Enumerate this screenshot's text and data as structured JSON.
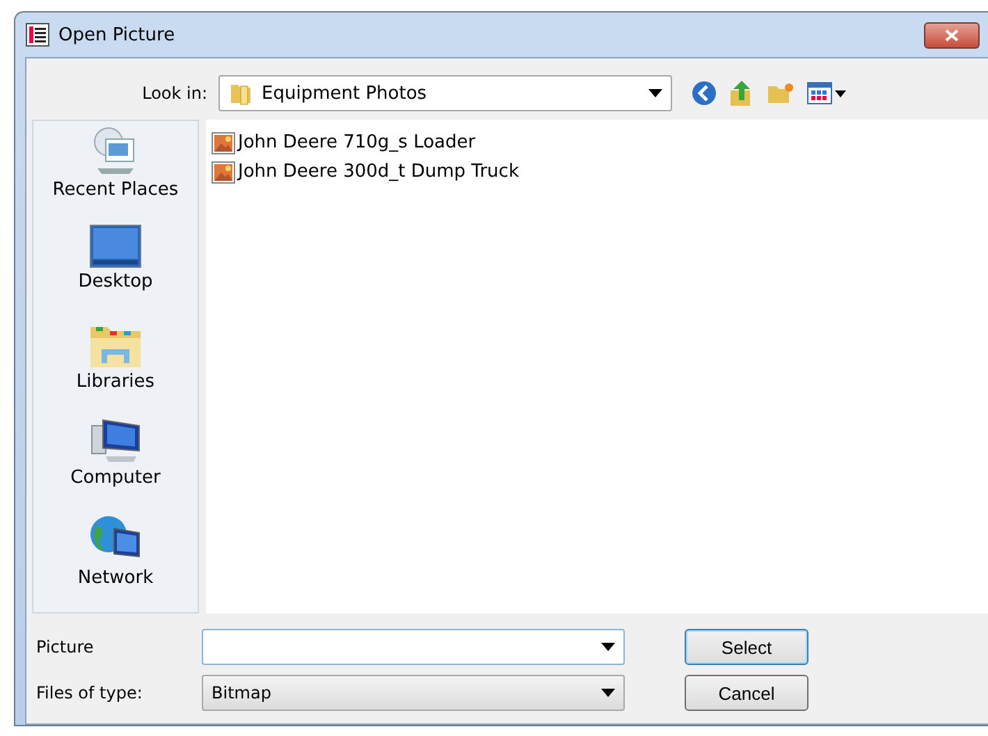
{
  "window": {
    "title": "Open Picture"
  },
  "look_in": {
    "label": "Look in:",
    "value": "Equipment Photos"
  },
  "places": [
    {
      "label": "Recent Places",
      "kind": "recent"
    },
    {
      "label": "Desktop",
      "kind": "desktop"
    },
    {
      "label": "Libraries",
      "kind": "libraries"
    },
    {
      "label": "Computer",
      "kind": "computer"
    },
    {
      "label": "Network",
      "kind": "network"
    }
  ],
  "files": [
    {
      "name": "John Deere 710g_s Loader",
      "selected": false
    },
    {
      "name": "John Deere 300d_t Dump Truck",
      "selected": false
    }
  ],
  "picture_field": {
    "label": "Picture"
  },
  "file_type": {
    "label": "Files of type:",
    "value": "Bitmap"
  },
  "buttons": [
    {
      "label": "Select",
      "default": true
    },
    {
      "label": "Cancel",
      "default": false
    }
  ]
}
